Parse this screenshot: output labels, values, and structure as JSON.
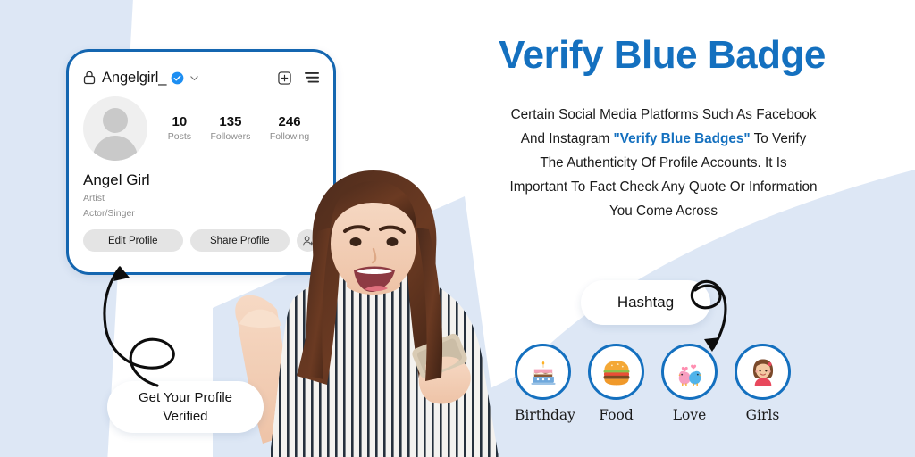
{
  "theme": {
    "bg_blue": "#dde7f5",
    "panel_white": "#ffffff",
    "accent_blue": "#1470bf",
    "card_border_blue": "#1466b0",
    "verified_blue": "#1d8ef2",
    "button_gray": "#e4e4e4",
    "muted_text": "#8e8e8e"
  },
  "headline": {
    "text": "Verify Blue Badge"
  },
  "body_copy": {
    "line1": "Certain Social Media Platforms Such As",
    "line2": "Facebook And Instagram",
    "highlight": "\"Verify Blue Badges\"",
    "line3_after_highlight": " To Verify The",
    "line4": "Authenticity Of Profile Accounts. It Is",
    "line5": "Important To Fact Check Any Quote Or",
    "line6": "Information You Come Across"
  },
  "profile_card": {
    "lock_icon": "lock-icon",
    "handle": "Angelgirl_",
    "verified_icon": "verified-badge-icon",
    "chevron_icon": "chevron-down-icon",
    "add_icon": "plus-square-icon",
    "menu_icon": "hamburger-menu-icon",
    "avatar_icon": "default-avatar-icon",
    "stats": [
      {
        "value": "10",
        "label": "Posts"
      },
      {
        "value": "135",
        "label": "Followers"
      },
      {
        "value": "246",
        "label": "Following"
      }
    ],
    "display_name": "Angel Girl",
    "bio_line1": "Artist",
    "bio_line2": "Actor/Singer",
    "buttons": {
      "edit": "Edit Profile",
      "share": "Share Profile",
      "add_person_icon": "add-person-icon"
    }
  },
  "callouts": {
    "hashtag": "Hashtag",
    "verified_line1": "Get Your Profile",
    "verified_line2": "Verified"
  },
  "categories": [
    {
      "label": "Birthday",
      "icon": "birthday-cake-icon",
      "glyph": "🎂"
    },
    {
      "label": "Food",
      "icon": "hamburger-food-icon",
      "glyph": "🍔"
    },
    {
      "label": "Love",
      "icon": "love-birds-icon",
      "glyph": "🐦"
    },
    {
      "label": "Girls",
      "icon": "girl-avatar-icon",
      "glyph": "👧"
    }
  ],
  "arrows": {
    "to_profile_card": "curly-arrow-up",
    "to_love_category": "curly-arrow-down"
  },
  "photo": {
    "subject": "smiling-woman-holding-phone"
  }
}
